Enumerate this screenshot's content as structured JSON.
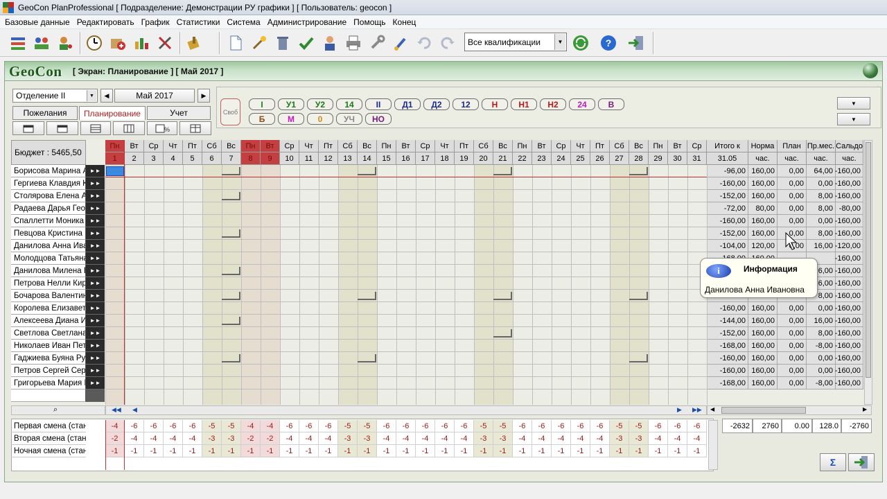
{
  "window": {
    "title": "GeoCon PlanProfessional [ Подразделение: Демонстрации РУ графики ] [ Пользователь: geocon ]"
  },
  "menu": [
    "Базовые данные",
    "Редактировать",
    "График",
    "Статистики",
    "Система",
    "Администрирование",
    "Помощь",
    "Конец"
  ],
  "toolbar": {
    "qualification_select": "Все квалификации"
  },
  "header": {
    "logo": "GeoCon",
    "screen_title": "[ Экран: Планирование ] [ Май 2017 ]"
  },
  "controls": {
    "department": "Отделение II",
    "month": "Май 2017",
    "tabs": [
      "Пожелания",
      "Планирование",
      "Учет"
    ],
    "active_tab": "Планирование"
  },
  "codes": {
    "svob": "Своб",
    "row1": [
      {
        "label": "I",
        "color": "#1a7a1a"
      },
      {
        "label": "У1",
        "color": "#1a7a1a"
      },
      {
        "label": "У2",
        "color": "#1a7a1a"
      },
      {
        "label": "14",
        "color": "#1a7a1a"
      },
      {
        "label": "II",
        "color": "#1a2a8a"
      },
      {
        "label": "Д1",
        "color": "#1a2a8a"
      },
      {
        "label": "Д2",
        "color": "#1a2a8a"
      },
      {
        "label": "12",
        "color": "#1a2a8a"
      },
      {
        "label": "Н",
        "color": "#b01a1a"
      },
      {
        "label": "Н1",
        "color": "#b01a1a"
      },
      {
        "label": "Н2",
        "color": "#b01a1a"
      },
      {
        "label": "24",
        "color": "#c01ac0"
      },
      {
        "label": "В",
        "color": "#7a1a7a"
      }
    ],
    "row2": [
      {
        "label": "Б",
        "color": "#8a4a1a"
      },
      {
        "label": "М",
        "color": "#c01ac0"
      },
      {
        "label": "0",
        "color": "#d08a1a"
      },
      {
        "label": "УЧ",
        "color": "#888888"
      },
      {
        "label": "НО",
        "color": "#7a1a7a"
      }
    ]
  },
  "grid": {
    "budget": "Бюджет : 5465,50",
    "weekdays": [
      "Пн",
      "Вт",
      "Ср",
      "Чт",
      "Пт",
      "Сб",
      "Вс",
      "Пн",
      "Вт",
      "Ср",
      "Чт",
      "Пт",
      "Сб",
      "Вс",
      "Пн",
      "Вт",
      "Ср",
      "Чт",
      "Пт",
      "Сб",
      "Вс",
      "Пн",
      "Вт",
      "Ср",
      "Чт",
      "Пт",
      "Сб",
      "Вс",
      "Пн",
      "Вт",
      "Ср"
    ],
    "days": [
      "1",
      "2",
      "3",
      "4",
      "5",
      "6",
      "7",
      "8",
      "9",
      "10",
      "11",
      "12",
      "13",
      "14",
      "15",
      "16",
      "17",
      "18",
      "19",
      "20",
      "21",
      "22",
      "23",
      "24",
      "25",
      "26",
      "27",
      "28",
      "29",
      "30",
      "31"
    ],
    "summary_headers": [
      {
        "top": "Итого к",
        "bottom": "31.05"
      },
      {
        "top": "Норма",
        "bottom": "час."
      },
      {
        "top": "План",
        "bottom": "час."
      },
      {
        "top": "Пр.мес.",
        "bottom": "час."
      },
      {
        "top": "Сальдо",
        "bottom": "час."
      }
    ],
    "employees": [
      {
        "name": "Борисова Марина А",
        "itogo": "-96,00",
        "norma": "160,00",
        "plan": "0,00",
        "prmes": "64,00",
        "saldo": "-160,00"
      },
      {
        "name": "Гергиева Клавдия К",
        "itogo": "-160,00",
        "norma": "160,00",
        "plan": "0,00",
        "prmes": "0,00",
        "saldo": "-160,00"
      },
      {
        "name": "Столярова Елена Ал",
        "itogo": "-152,00",
        "norma": "160,00",
        "plan": "0,00",
        "prmes": "8,00",
        "saldo": "-160,00"
      },
      {
        "name": "Радаева Дарья Геор",
        "itogo": "-72,00",
        "norma": "80,00",
        "plan": "0,00",
        "prmes": "8,00",
        "saldo": "-80,00"
      },
      {
        "name": "Спаллетти Моника А",
        "itogo": "-160,00",
        "norma": "160,00",
        "plan": "0,00",
        "prmes": "0,00",
        "saldo": "-160,00"
      },
      {
        "name": "Певцова Кристина М",
        "itogo": "-152,00",
        "norma": "160,00",
        "plan": "0,00",
        "prmes": "8,00",
        "saldo": "-160,00"
      },
      {
        "name": "Данилова Анна Ива",
        "itogo": "-104,00",
        "norma": "120,00",
        "plan": "0,00",
        "prmes": "16,00",
        "saldo": "-120,00"
      },
      {
        "name": "Молодцова Татьяна",
        "itogo": "-168,00",
        "norma": "160,00",
        "plan": "",
        "prmes": "",
        "saldo": "-160,00"
      },
      {
        "name": "Данилова Милена В",
        "itogo": "",
        "norma": "",
        "plan": "",
        "prmes": "6,00",
        "saldo": "-160,00"
      },
      {
        "name": "Петрова Нелли Кири",
        "itogo": "",
        "norma": "",
        "plan": "",
        "prmes": "6,00",
        "saldo": "-160,00"
      },
      {
        "name": "Бочарова Валентина",
        "itogo": "",
        "norma": "",
        "plan": "",
        "prmes": "8,00",
        "saldo": "-160,00"
      },
      {
        "name": "Королева Елизавет",
        "itogo": "-160,00",
        "norma": "160,00",
        "plan": "0,00",
        "prmes": "0,00",
        "saldo": "-160,00"
      },
      {
        "name": "Алексеева Диана И",
        "itogo": "-144,00",
        "norma": "160,00",
        "plan": "0,00",
        "prmes": "16,00",
        "saldo": "-160,00"
      },
      {
        "name": "Светлова Светлана",
        "itogo": "-152,00",
        "norma": "160,00",
        "plan": "0,00",
        "prmes": "8,00",
        "saldo": "-160,00"
      },
      {
        "name": "Николаев Иван Пет",
        "itogo": "-168,00",
        "norma": "160,00",
        "plan": "0,00",
        "prmes": "-8,00",
        "saldo": "-160,00"
      },
      {
        "name": "Гаджиева Буяна Руд",
        "itogo": "-160,00",
        "norma": "160,00",
        "plan": "0,00",
        "prmes": "0,00",
        "saldo": "-160,00"
      },
      {
        "name": "Петров Сергей Серг",
        "itogo": "-160,00",
        "norma": "160,00",
        "plan": "0,00",
        "prmes": "0,00",
        "saldo": "-160,00"
      },
      {
        "name": "Григорьева Мария И",
        "itogo": "-168,00",
        "norma": "160,00",
        "plan": "0,00",
        "prmes": "-8,00",
        "saldo": "-160,00"
      }
    ]
  },
  "shifts": [
    {
      "name": "Первая смена (стан",
      "values": [
        "-4",
        "-6",
        "-6",
        "-6",
        "-6",
        "-5",
        "-5",
        "-4",
        "-4",
        "-6",
        "-6",
        "-6",
        "-5",
        "-5",
        "-6",
        "-6",
        "-6",
        "-6",
        "-6",
        "-5",
        "-5",
        "-6",
        "-6",
        "-6",
        "-6",
        "-6",
        "-5",
        "-5",
        "-6",
        "-6",
        "-6"
      ]
    },
    {
      "name": "Вторая смена (стан",
      "values": [
        "-2",
        "-4",
        "-4",
        "-4",
        "-4",
        "-3",
        "-3",
        "-2",
        "-2",
        "-4",
        "-4",
        "-4",
        "-3",
        "-3",
        "-4",
        "-4",
        "-4",
        "-4",
        "-4",
        "-3",
        "-3",
        "-4",
        "-4",
        "-4",
        "-4",
        "-4",
        "-3",
        "-3",
        "-4",
        "-4",
        "-4"
      ]
    },
    {
      "name": "Ночная смена (стан",
      "values": [
        "-1",
        "-1",
        "-1",
        "-1",
        "-1",
        "-1",
        "-1",
        "-1",
        "-1",
        "-1",
        "-1",
        "-1",
        "-1",
        "-1",
        "-1",
        "-1",
        "-1",
        "-1",
        "-1",
        "-1",
        "-1",
        "-1",
        "-1",
        "-1",
        "-1",
        "-1",
        "-1",
        "-1",
        "-1",
        "-1",
        "-1"
      ]
    }
  ],
  "totals": [
    "-2632",
    "2760",
    "0.00",
    "128.0",
    "-2760"
  ],
  "tooltip": {
    "title": "Информация",
    "body": "Данилова Анна Ивановна"
  },
  "buttons": {
    "sum": "Σ"
  }
}
